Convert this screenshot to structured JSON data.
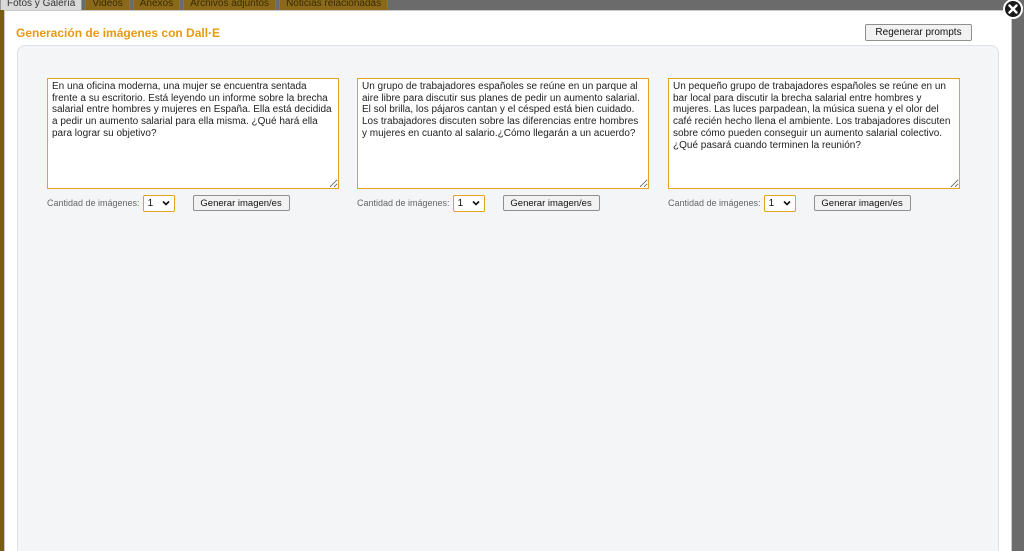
{
  "background_tabs": [
    "Fotos y Galería",
    "Videos",
    "Anexos",
    "Archivos adjuntos",
    "Noticias relacionadas"
  ],
  "modal": {
    "title": "Generación de imágenes con Dall·E",
    "regenerate_label": "Regenerar prompts",
    "close_icon": "close-icon"
  },
  "prompts": [
    {
      "text": "En una oficina moderna, una mujer se encuentra sentada frente a su escritorio. Está leyendo un informe sobre la brecha salarial entre hombres y mujeres en España. Ella está decidida a pedir un aumento salarial para ella misma. ¿Qué hará ella para lograr su objetivo?",
      "qty_label": "Cantidad de imágenes:",
      "qty_value": "1",
      "generate_label": "Generar imagen/es"
    },
    {
      "text": "Un grupo de trabajadores españoles se reúne en un parque al aire libre para discutir sus planes de pedir un aumento salarial. El sol brilla, los pájaros cantan y el césped está bien cuidado. Los trabajadores discuten sobre las diferencias entre hombres y mujeres en cuanto al salario.¿Cómo llegarán a un acuerdo?",
      "qty_label": "Cantidad de imágenes:",
      "qty_value": "1",
      "generate_label": "Generar imagen/es"
    },
    {
      "text": "Un pequeño grupo de trabajadores españoles se reúne en un bar local para discutir la brecha salarial entre hombres y mujeres. Las luces parpadean, la música suena y el olor del café recién hecho llena el ambiente. Los trabajadores discuten sobre cómo pueden conseguir un aumento salarial colectivo.¿Qué pasará cuando terminen la reunión?",
      "qty_label": "Cantidad de imágenes:",
      "qty_value": "1",
      "generate_label": "Generar imagen/es"
    }
  ],
  "colors": {
    "accent": "#e69a12",
    "field_border": "#e2a322",
    "panel_bg": "#f4f5f7"
  }
}
